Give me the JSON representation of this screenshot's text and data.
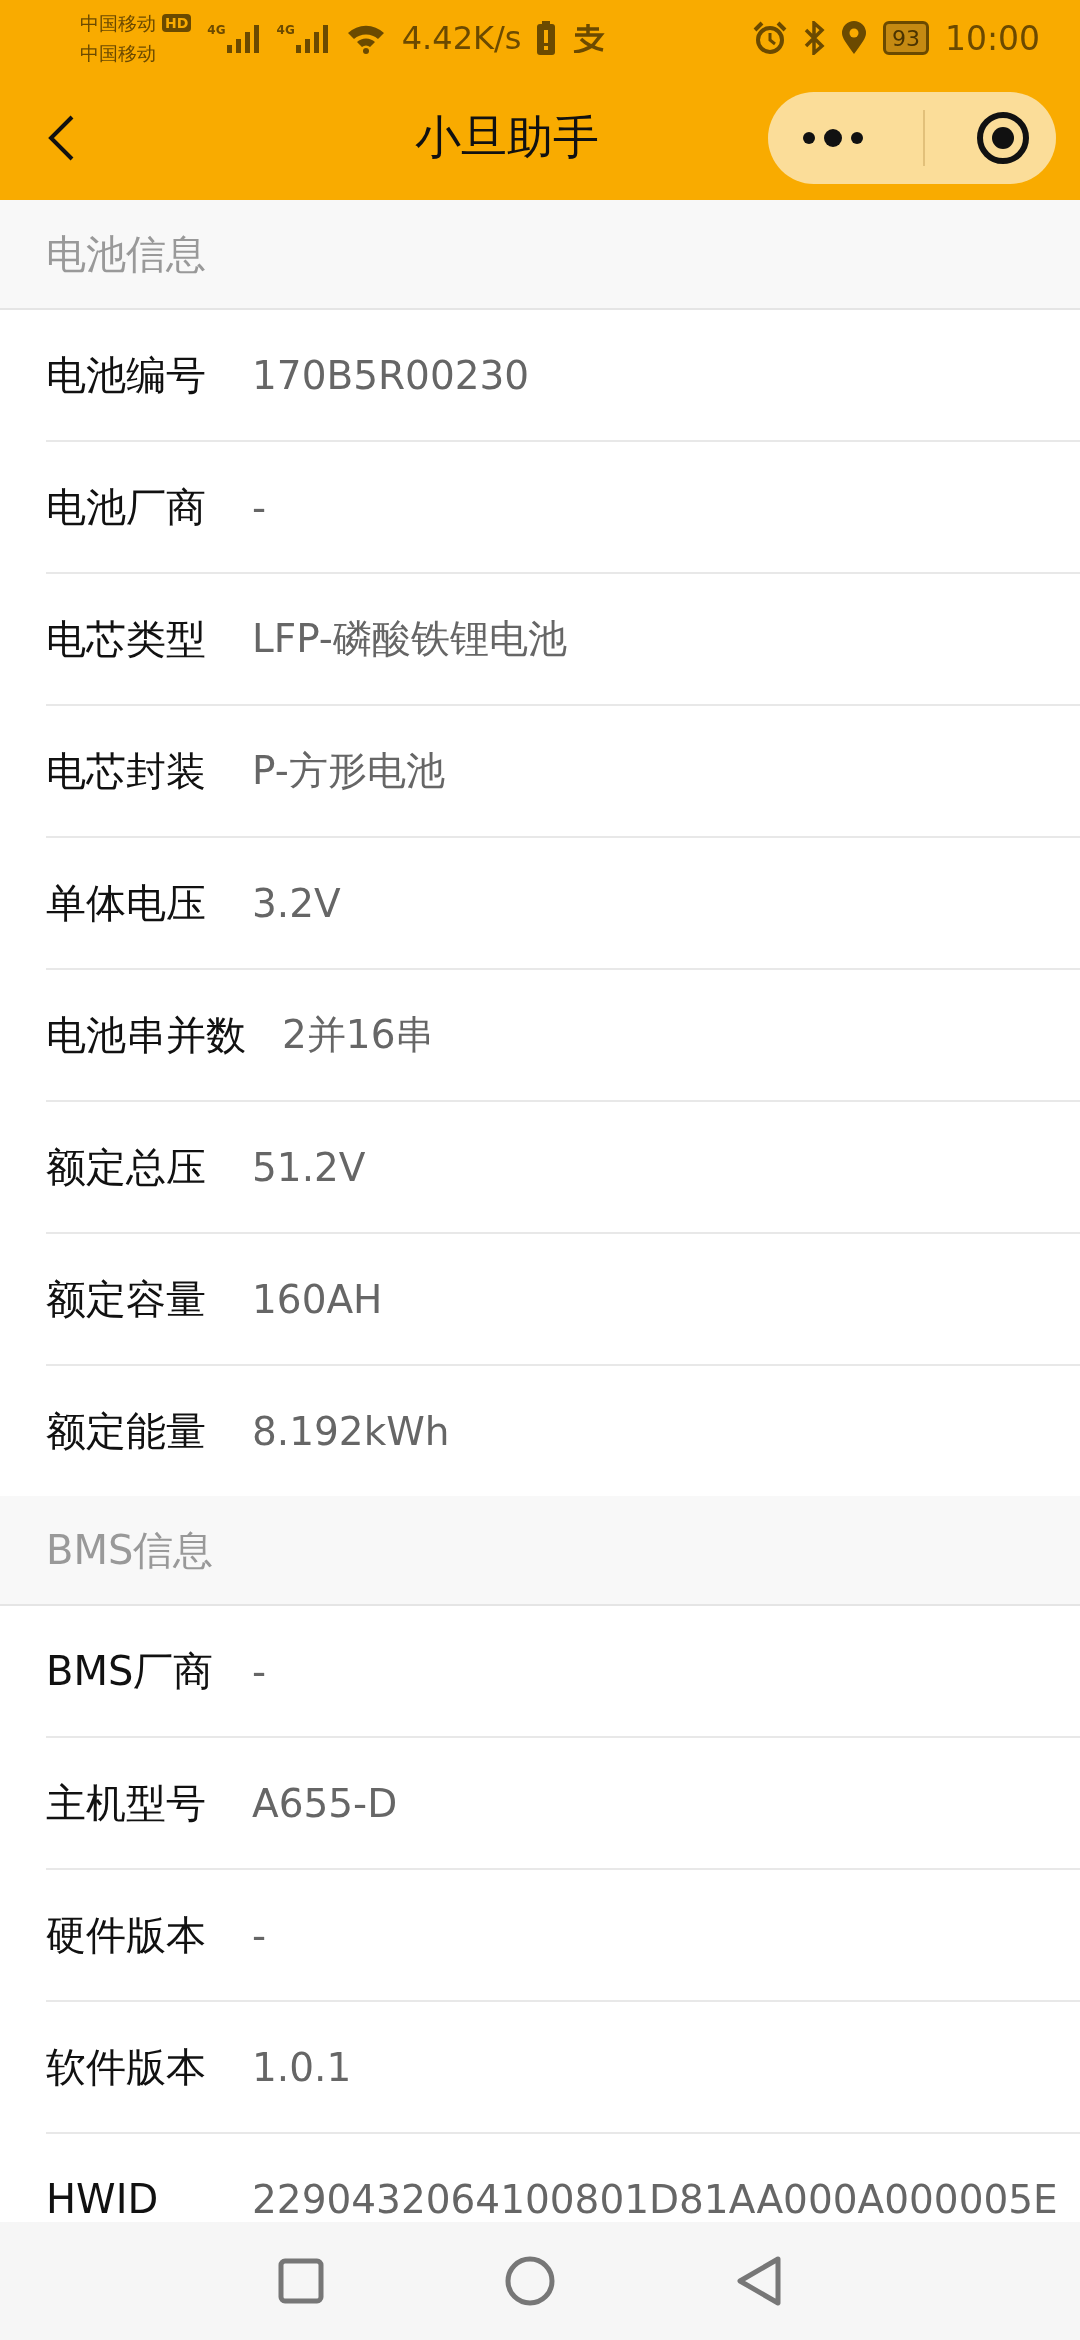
{
  "status_bar": {
    "carriers": [
      "中国移动",
      "中国移动"
    ],
    "hd_badge": "HD",
    "network_types": [
      "4G",
      "4G"
    ],
    "net_speed": "4.42K/s",
    "battery": "93",
    "time": "10:00"
  },
  "nav_bar": {
    "title": "小旦助手"
  },
  "sections": [
    {
      "title": "电池信息",
      "rows": [
        {
          "label": "电池编号",
          "value": "170B5R00230"
        },
        {
          "label": "电池厂商",
          "value": "-"
        },
        {
          "label": "电芯类型",
          "value": "LFP-磷酸铁锂电池"
        },
        {
          "label": "电芯封装",
          "value": "P-方形电池"
        },
        {
          "label": "单体电压",
          "value": "3.2V"
        },
        {
          "label": "电池串并数",
          "value": "2并16串"
        },
        {
          "label": "额定总压",
          "value": "51.2V"
        },
        {
          "label": "额定容量",
          "value": "160AH"
        },
        {
          "label": "额定能量",
          "value": "8.192kWh"
        }
      ]
    },
    {
      "title": "BMS信息",
      "rows": [
        {
          "label": "BMS厂商",
          "value": "-"
        },
        {
          "label": "主机型号",
          "value": "A655-D"
        },
        {
          "label": "硬件版本",
          "value": "-"
        },
        {
          "label": "软件版本",
          "value": "1.0.1"
        },
        {
          "label": "HWID",
          "value": "2290432064100801D81AA000A000005E"
        }
      ]
    }
  ]
}
